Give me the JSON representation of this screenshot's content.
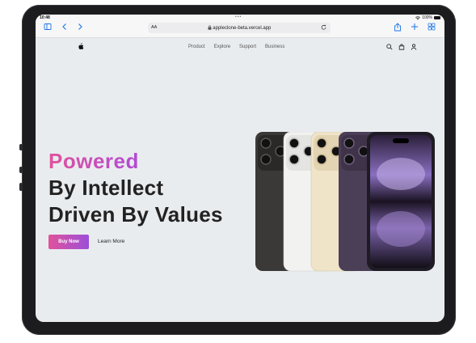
{
  "status_bar": {
    "time": "10:48",
    "dots": "•••",
    "battery": "100%"
  },
  "browser": {
    "text_size_label": "AA",
    "url": "appleclone-beta.vercel.app",
    "icons": [
      "sidebar-icon",
      "back-icon",
      "forward-icon",
      "lock-icon",
      "reload-icon",
      "share-icon",
      "new-tab-icon",
      "tabs-overview-icon"
    ]
  },
  "nav": {
    "links": [
      "Product",
      "Explore",
      "Support",
      "Business"
    ],
    "icons": [
      "apple-logo-icon",
      "search-icon",
      "bag-icon",
      "user-icon"
    ]
  },
  "hero": {
    "line1": "Powered",
    "line2": "By Intellect",
    "line3": "Driven By Values",
    "primary_button": "Buy Now",
    "secondary_link": "Learn More"
  },
  "colors": {
    "accent_gradient_start": "#e0529c",
    "accent_gradient_end": "#9c4fd8",
    "screen_background": "#e9ecef",
    "link_blue": "#1a73e8",
    "phone_colors": [
      "#3a3937",
      "#f2f2f0",
      "#efe3c8",
      "#4b3f57",
      "#1f1b24"
    ]
  }
}
